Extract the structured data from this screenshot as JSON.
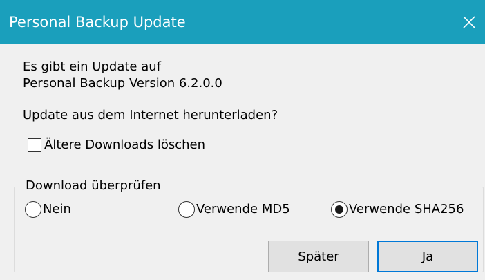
{
  "window": {
    "title": "Personal Backup Update",
    "title_bar_color": "#1a9fbc",
    "close_icon": "close-icon"
  },
  "message": {
    "line1": "Es gibt ein Update auf",
    "line2": "Personal Backup Version 6.2.0.0",
    "question": "Update aus dem Internet herunterladen?"
  },
  "checkbox": {
    "label": "Ältere Downloads löschen",
    "checked": false
  },
  "verify_group": {
    "legend": "Download überprüfen",
    "options": [
      {
        "label": "Nein",
        "selected": false
      },
      {
        "label": "Verwende MD5",
        "selected": false
      },
      {
        "label": "Verwende SHA256",
        "selected": true
      }
    ]
  },
  "buttons": {
    "later_label": "Später",
    "yes_label": "Ja",
    "default_button_accent": "#0078d7"
  }
}
